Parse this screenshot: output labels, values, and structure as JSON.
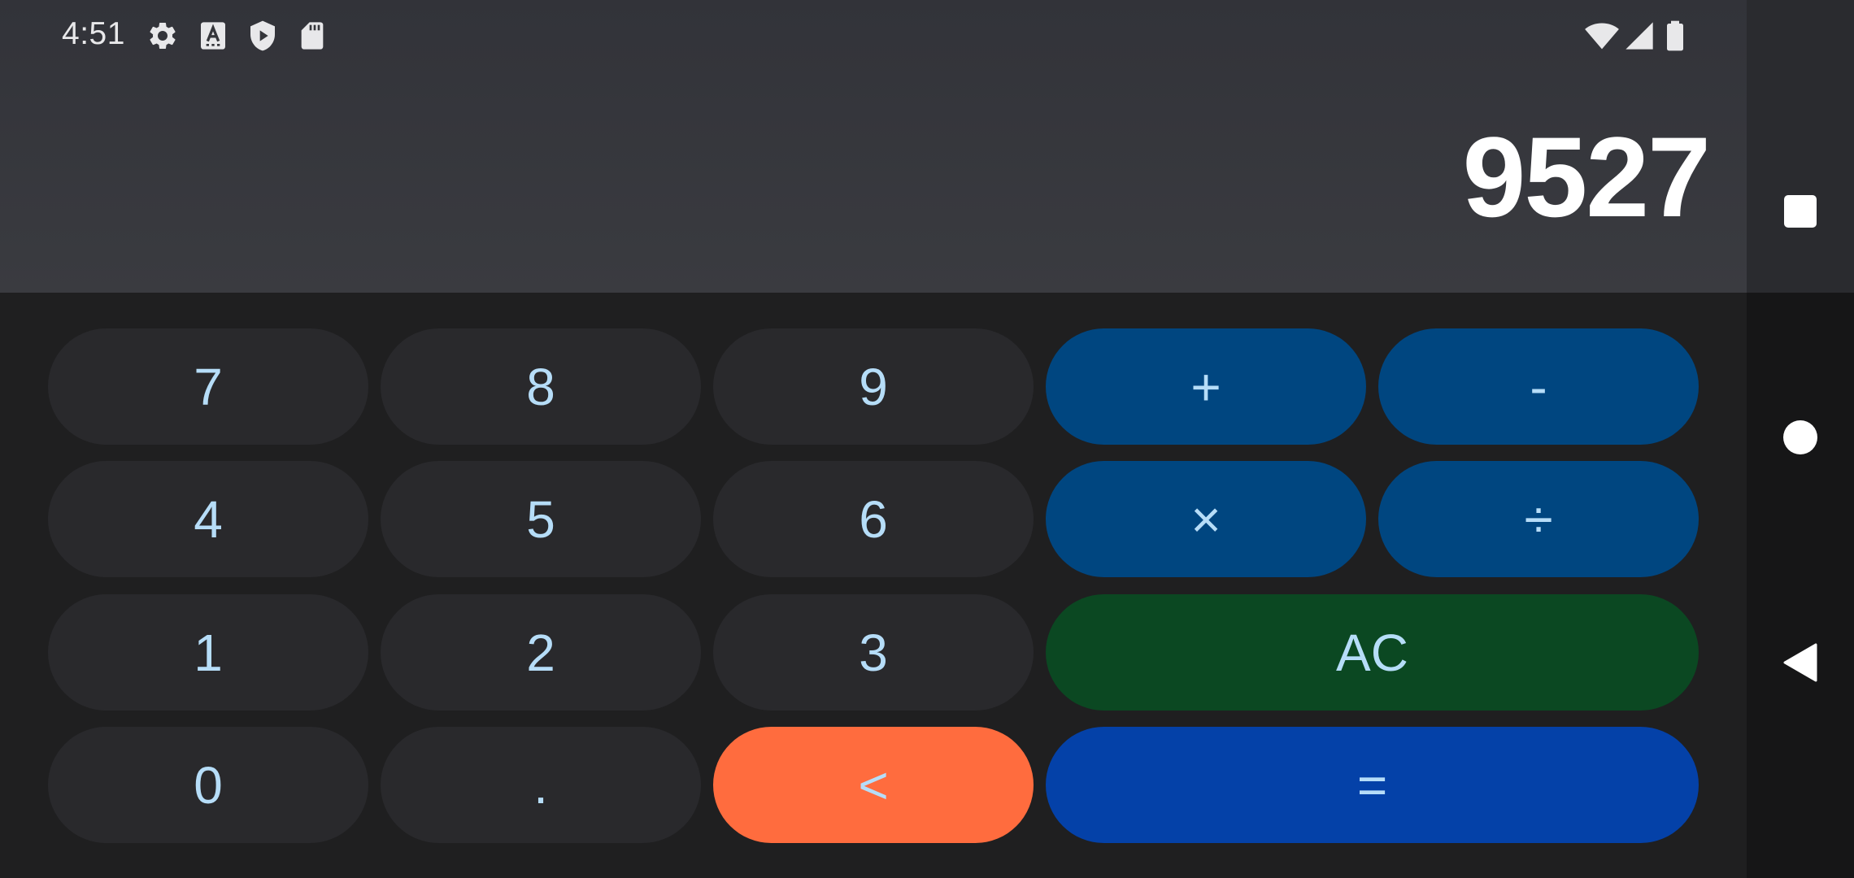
{
  "status_bar": {
    "time": "4:51",
    "left_icons": [
      "gear-icon",
      "font-a-icon",
      "play-protect-shield-icon",
      "sd-card-icon"
    ],
    "right_icons": [
      "wifi-icon",
      "cell-signal-icon",
      "battery-icon"
    ]
  },
  "display": {
    "value": "9527"
  },
  "keypad": {
    "rows": [
      [
        {
          "label": "7",
          "kind": "number"
        },
        {
          "label": "8",
          "kind": "number"
        },
        {
          "label": "9",
          "kind": "number"
        },
        {
          "label": "+",
          "kind": "operator"
        },
        {
          "label": "-",
          "kind": "operator"
        }
      ],
      [
        {
          "label": "4",
          "kind": "number"
        },
        {
          "label": "5",
          "kind": "number"
        },
        {
          "label": "6",
          "kind": "number"
        },
        {
          "label": "×",
          "kind": "operator"
        },
        {
          "label": "÷",
          "kind": "operator"
        }
      ],
      [
        {
          "label": "1",
          "kind": "number"
        },
        {
          "label": "2",
          "kind": "number"
        },
        {
          "label": "3",
          "kind": "number"
        },
        {
          "label": "AC",
          "kind": "clear"
        }
      ],
      [
        {
          "label": "0",
          "kind": "number"
        },
        {
          "label": ".",
          "kind": "number"
        },
        {
          "label": "<",
          "kind": "backspace"
        },
        {
          "label": "=",
          "kind": "equals"
        }
      ]
    ]
  },
  "colors": {
    "number_key": "#29292c",
    "operator_key": "#004680",
    "clear_key": "#0b4822",
    "backspace_key": "#ff6c3e",
    "equals_key": "#0441a8",
    "key_text": "#b6ddf8",
    "display_text": "#ffffff"
  },
  "navigation_bar": {
    "buttons": [
      "recents-square-icon",
      "home-circle-icon",
      "back-triangle-icon"
    ]
  }
}
